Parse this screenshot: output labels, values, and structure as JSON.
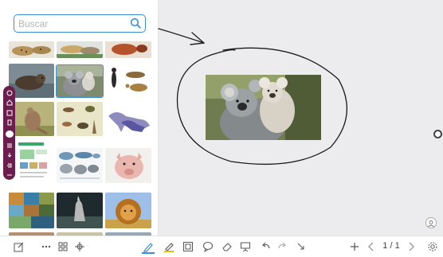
{
  "search": {
    "placeholder": "Buscar"
  },
  "pagination": {
    "indicator": "1 / 1"
  },
  "thumbnails": [
    "cheetahs",
    "jaguars",
    "red-animal",
    "otters",
    "koala-selected",
    "primate-silhouettes",
    "kangaroo",
    "birds-collage",
    "dinosaurs",
    "infographic",
    "mammals-chart",
    "pig",
    "wildlife-collage",
    "wolf",
    "lion"
  ],
  "colors": {
    "accent": "#3a8fd8",
    "vertical_toolbar": "#6b1d4d",
    "highlighter": "#f2b705"
  }
}
